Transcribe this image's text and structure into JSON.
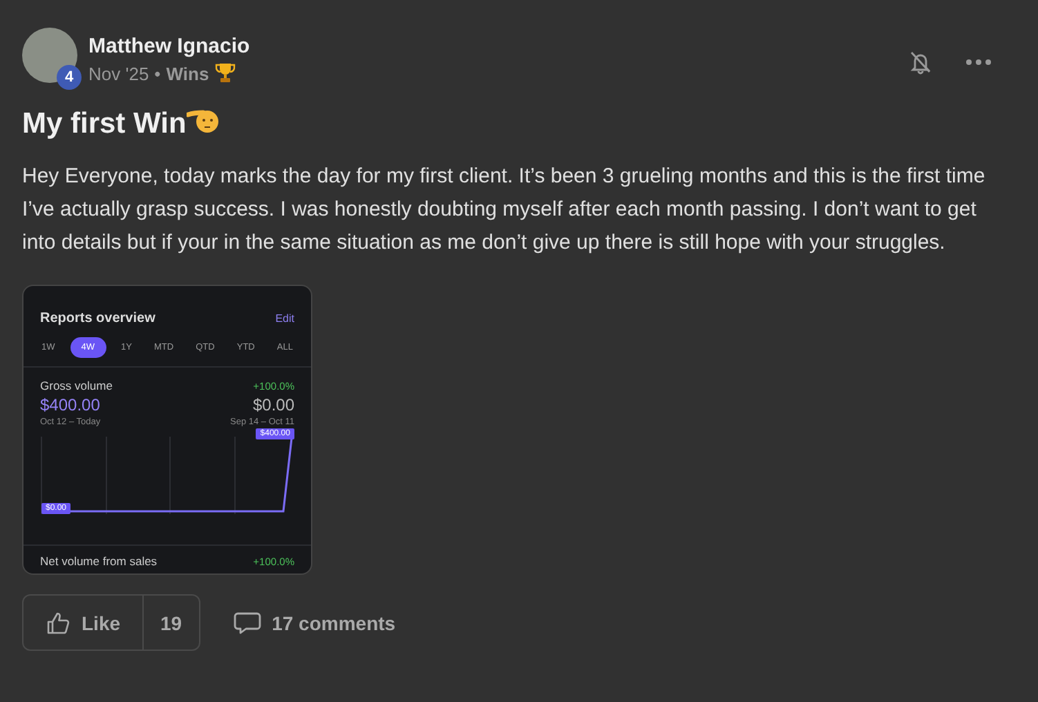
{
  "post": {
    "author": "Matthew Ignacio",
    "level_badge": "4",
    "date": "Nov '25",
    "separator": "•",
    "category": "Wins",
    "title": "My first Win",
    "body": "Hey Everyone, today marks the day for my first client. It’s been 3 grueling months and this is the first time I’ve actually grasp success. I was honestly doubting myself after each month passing. I don’t want to get into details but if your in the same situation as me don’t give up there is still hope with your struggles."
  },
  "attachment": {
    "title": "Reports overview",
    "edit": "Edit",
    "ranges": [
      {
        "label": "1W",
        "selected": false
      },
      {
        "label": "4W",
        "selected": true
      },
      {
        "label": "1Y",
        "selected": false
      },
      {
        "label": "MTD",
        "selected": false
      },
      {
        "label": "QTD",
        "selected": false
      },
      {
        "label": "YTD",
        "selected": false
      },
      {
        "label": "ALL",
        "selected": false
      }
    ],
    "metric": "Gross volume",
    "change": "+100.0%",
    "current": "$400.00",
    "previous": "$0.00",
    "current_period": "Oct 12 – Today",
    "previous_period": "Sep 14 – Oct 11",
    "start_label": "$0.00",
    "end_label": "$400.00",
    "next_metric": "Net volume from sales",
    "next_change": "+100.0%"
  },
  "actions": {
    "like": "Like",
    "like_count": "19",
    "comments": "17 comments"
  }
}
